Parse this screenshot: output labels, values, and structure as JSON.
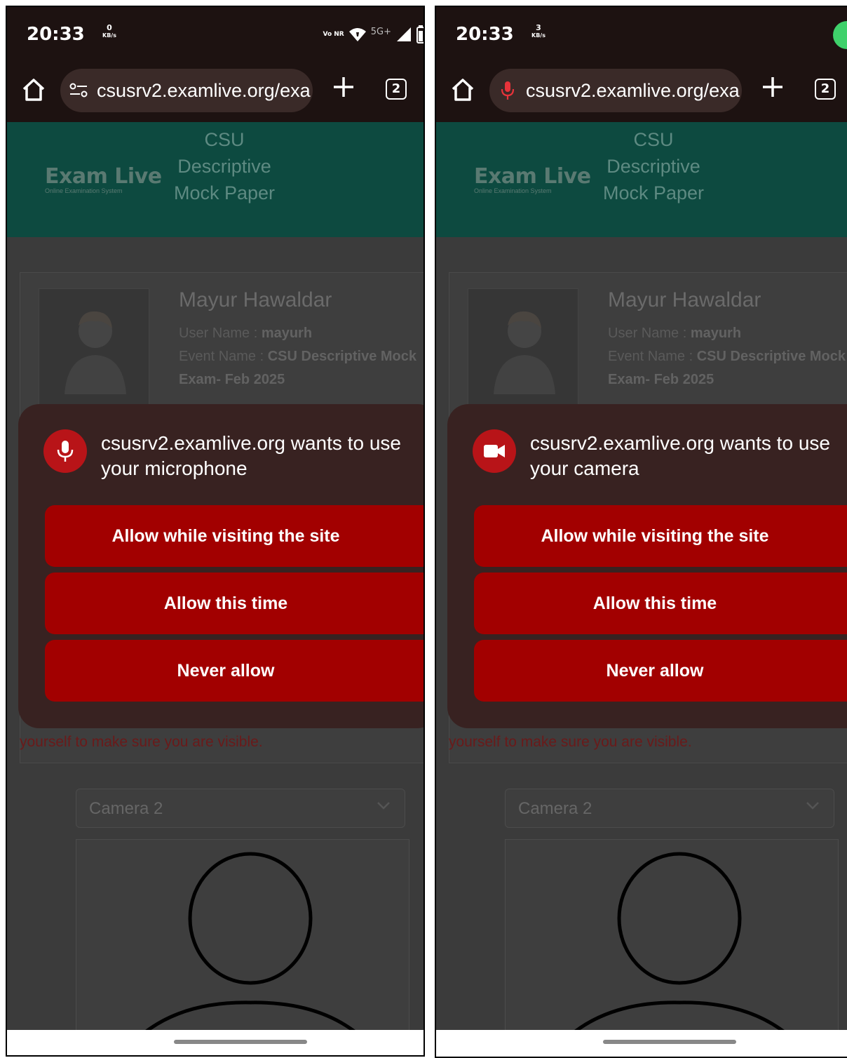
{
  "left": {
    "status": {
      "time": "20:33",
      "net_value": "0",
      "net_unit": "KB/s",
      "volte": "Vo NR",
      "network": "5G+"
    },
    "browser": {
      "url": "csusrv2.examlive.org/exa",
      "tab_count": "2"
    },
    "page": {
      "logo_title": "Exam Live",
      "logo_subtitle": "Online Examination System",
      "header_title": "CSU Descriptive Mock Paper",
      "user_full_name": "Mayur  Hawaldar",
      "user_name_label": "User Name : ",
      "user_name_value": "mayurh",
      "event_label": "Event Name : ",
      "event_value": "CSU Descriptive Mock Exam- Feb 2025",
      "hint": "yourself to make sure you are visible.",
      "camera_select": "Camera 2"
    },
    "dialog": {
      "message": "csusrv2.examlive.org wants to use your microphone",
      "allow_site": "Allow while visiting the site",
      "allow_once": "Allow this time",
      "never": "Never allow"
    }
  },
  "right": {
    "status": {
      "time": "20:33",
      "net_value": "3",
      "net_unit": "KB/s"
    },
    "browser": {
      "url": "csusrv2.examlive.org/exa",
      "tab_count": "2"
    },
    "page": {
      "logo_title": "Exam Live",
      "logo_subtitle": "Online Examination System",
      "header_title": "CSU Descriptive Mock Paper",
      "user_full_name": "Mayur  Hawaldar",
      "user_name_label": "User Name : ",
      "user_name_value": "mayurh",
      "event_label": "Event Name : ",
      "event_value": "CSU Descriptive Mock Exam- Feb 2025",
      "hint": "yourself to make sure you are visible.",
      "camera_select": "Camera 2"
    },
    "dialog": {
      "message": "csusrv2.examlive.org wants to use your camera",
      "allow_site": "Allow while visiting the site",
      "allow_once": "Allow this time",
      "never": "Never allow"
    }
  },
  "colors": {
    "dialog_bg": "#382221",
    "button_red": "#a20000",
    "icon_red": "#b81418",
    "header_teal": "#0d4a40",
    "status_green": "#3fd16b"
  }
}
